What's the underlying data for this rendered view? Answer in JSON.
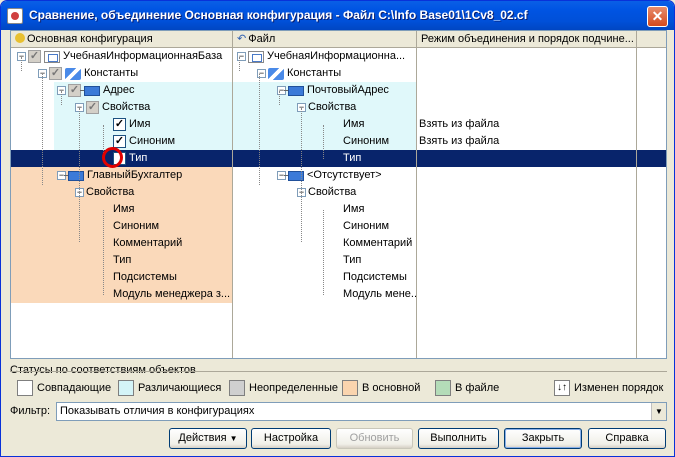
{
  "window": {
    "title": "Сравнение, объединение Основная конфигурация - Файл C:\\Info Base01\\1Cv8_02.cf",
    "close": "✕"
  },
  "columns": {
    "main": "Основная конфигурация",
    "file": "Файл",
    "mode": "Режим объединения и порядок подчине..."
  },
  "rows": [
    {
      "main": "УчебнаяИнформационнаяБаза",
      "file": "УчебнаяИнформационна...",
      "mode": ""
    },
    {
      "main": "Константы",
      "file": "Константы",
      "mode": ""
    },
    {
      "main": "Адрес",
      "file": "ПочтовыйАдрес",
      "mode": ""
    },
    {
      "main": "Свойства",
      "file": "Свойства",
      "mode": ""
    },
    {
      "main": "Имя",
      "file": "Имя",
      "mode": "Взять из файла"
    },
    {
      "main": "Синоним",
      "file": "Синоним",
      "mode": "Взять из файла"
    },
    {
      "main": "Тип",
      "file": "Тип",
      "mode": ""
    },
    {
      "main": "ГлавныйБухгалтер",
      "file": "<Отсутствует>",
      "mode": ""
    },
    {
      "main": "Свойства",
      "file": "Свойства",
      "mode": ""
    },
    {
      "main": "Имя",
      "file": "Имя",
      "mode": ""
    },
    {
      "main": "Синоним",
      "file": "Синоним",
      "mode": ""
    },
    {
      "main": "Комментарий",
      "file": "Комментарий",
      "mode": ""
    },
    {
      "main": "Тип",
      "file": "Тип",
      "mode": ""
    },
    {
      "main": "Подсистемы",
      "file": "Подсистемы",
      "mode": ""
    },
    {
      "main": "Модуль менеджера з...",
      "file": "Модуль мене...",
      "mode": ""
    }
  ],
  "status": {
    "label": "Статусы по соответствиям объектов",
    "items": [
      {
        "label": "Совпадающие",
        "color": "#FFFFFF"
      },
      {
        "label": "Различающиеся",
        "color": "#D4F4F7"
      },
      {
        "label": "Неопределенные",
        "color": "#CFCFCF"
      },
      {
        "label": "В основной",
        "color": "#FAD4AE"
      },
      {
        "label": "В файле",
        "color": "#B4DCB8"
      }
    ],
    "order_label": "Изменен порядок"
  },
  "filter": {
    "label": "Фильтр:",
    "value": "Показывать отличия в конфигурациях"
  },
  "buttons": {
    "actions": "Действия",
    "settings": "Настройка",
    "refresh": "Обновить",
    "execute": "Выполнить",
    "close": "Закрыть",
    "help": "Справка"
  }
}
